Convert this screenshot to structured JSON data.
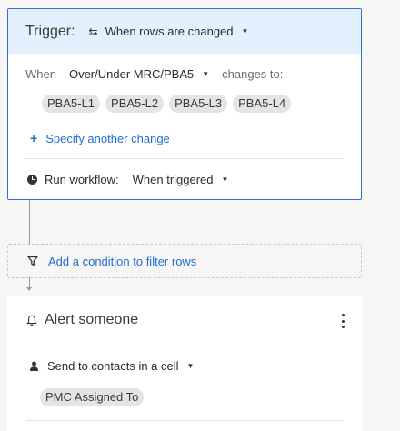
{
  "trigger": {
    "title": "Trigger:",
    "type_icon": "swap-arrows-icon",
    "type_label": "When rows are changed",
    "when_label": "When",
    "field_label": "Over/Under MRC/PBA5",
    "changes_to_label": "changes to:",
    "values": [
      "PBA5-L1",
      "PBA5-L2",
      "PBA5-L3",
      "PBA5-L4"
    ],
    "add_change_label": "Specify another change",
    "run_label": "Run workflow:",
    "run_value": "When triggered"
  },
  "condition": {
    "icon": "filter-icon",
    "label": "Add a condition to filter rows"
  },
  "action": {
    "icon": "bell-icon",
    "title": "Alert someone",
    "send_label": "Send to contacts in a cell",
    "contact_value": "PMC Assigned To"
  },
  "colors": {
    "accent": "#2e6fcf",
    "link": "#1e6ed0",
    "header_bg": "#e3f0fd",
    "page_bg": "#f7f6f4",
    "chip_bg": "#e4e4e4"
  }
}
